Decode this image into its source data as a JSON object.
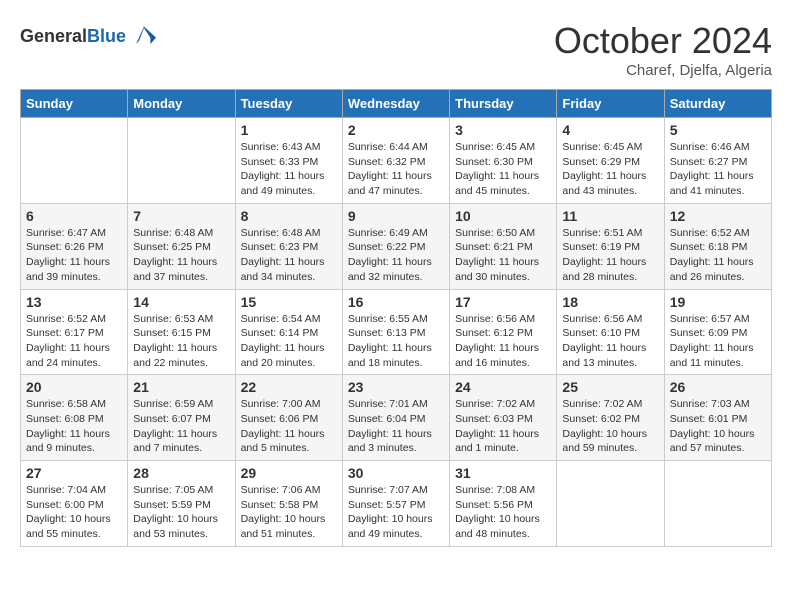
{
  "header": {
    "logo_general": "General",
    "logo_blue": "Blue",
    "month_title": "October 2024",
    "location": "Charef, Djelfa, Algeria"
  },
  "weekdays": [
    "Sunday",
    "Monday",
    "Tuesday",
    "Wednesday",
    "Thursday",
    "Friday",
    "Saturday"
  ],
  "weeks": [
    [
      {
        "day": "",
        "info": ""
      },
      {
        "day": "",
        "info": ""
      },
      {
        "day": "1",
        "info": "Sunrise: 6:43 AM\nSunset: 6:33 PM\nDaylight: 11 hours and 49 minutes."
      },
      {
        "day": "2",
        "info": "Sunrise: 6:44 AM\nSunset: 6:32 PM\nDaylight: 11 hours and 47 minutes."
      },
      {
        "day": "3",
        "info": "Sunrise: 6:45 AM\nSunset: 6:30 PM\nDaylight: 11 hours and 45 minutes."
      },
      {
        "day": "4",
        "info": "Sunrise: 6:45 AM\nSunset: 6:29 PM\nDaylight: 11 hours and 43 minutes."
      },
      {
        "day": "5",
        "info": "Sunrise: 6:46 AM\nSunset: 6:27 PM\nDaylight: 11 hours and 41 minutes."
      }
    ],
    [
      {
        "day": "6",
        "info": "Sunrise: 6:47 AM\nSunset: 6:26 PM\nDaylight: 11 hours and 39 minutes."
      },
      {
        "day": "7",
        "info": "Sunrise: 6:48 AM\nSunset: 6:25 PM\nDaylight: 11 hours and 37 minutes."
      },
      {
        "day": "8",
        "info": "Sunrise: 6:48 AM\nSunset: 6:23 PM\nDaylight: 11 hours and 34 minutes."
      },
      {
        "day": "9",
        "info": "Sunrise: 6:49 AM\nSunset: 6:22 PM\nDaylight: 11 hours and 32 minutes."
      },
      {
        "day": "10",
        "info": "Sunrise: 6:50 AM\nSunset: 6:21 PM\nDaylight: 11 hours and 30 minutes."
      },
      {
        "day": "11",
        "info": "Sunrise: 6:51 AM\nSunset: 6:19 PM\nDaylight: 11 hours and 28 minutes."
      },
      {
        "day": "12",
        "info": "Sunrise: 6:52 AM\nSunset: 6:18 PM\nDaylight: 11 hours and 26 minutes."
      }
    ],
    [
      {
        "day": "13",
        "info": "Sunrise: 6:52 AM\nSunset: 6:17 PM\nDaylight: 11 hours and 24 minutes."
      },
      {
        "day": "14",
        "info": "Sunrise: 6:53 AM\nSunset: 6:15 PM\nDaylight: 11 hours and 22 minutes."
      },
      {
        "day": "15",
        "info": "Sunrise: 6:54 AM\nSunset: 6:14 PM\nDaylight: 11 hours and 20 minutes."
      },
      {
        "day": "16",
        "info": "Sunrise: 6:55 AM\nSunset: 6:13 PM\nDaylight: 11 hours and 18 minutes."
      },
      {
        "day": "17",
        "info": "Sunrise: 6:56 AM\nSunset: 6:12 PM\nDaylight: 11 hours and 16 minutes."
      },
      {
        "day": "18",
        "info": "Sunrise: 6:56 AM\nSunset: 6:10 PM\nDaylight: 11 hours and 13 minutes."
      },
      {
        "day": "19",
        "info": "Sunrise: 6:57 AM\nSunset: 6:09 PM\nDaylight: 11 hours and 11 minutes."
      }
    ],
    [
      {
        "day": "20",
        "info": "Sunrise: 6:58 AM\nSunset: 6:08 PM\nDaylight: 11 hours and 9 minutes."
      },
      {
        "day": "21",
        "info": "Sunrise: 6:59 AM\nSunset: 6:07 PM\nDaylight: 11 hours and 7 minutes."
      },
      {
        "day": "22",
        "info": "Sunrise: 7:00 AM\nSunset: 6:06 PM\nDaylight: 11 hours and 5 minutes."
      },
      {
        "day": "23",
        "info": "Sunrise: 7:01 AM\nSunset: 6:04 PM\nDaylight: 11 hours and 3 minutes."
      },
      {
        "day": "24",
        "info": "Sunrise: 7:02 AM\nSunset: 6:03 PM\nDaylight: 11 hours and 1 minute."
      },
      {
        "day": "25",
        "info": "Sunrise: 7:02 AM\nSunset: 6:02 PM\nDaylight: 10 hours and 59 minutes."
      },
      {
        "day": "26",
        "info": "Sunrise: 7:03 AM\nSunset: 6:01 PM\nDaylight: 10 hours and 57 minutes."
      }
    ],
    [
      {
        "day": "27",
        "info": "Sunrise: 7:04 AM\nSunset: 6:00 PM\nDaylight: 10 hours and 55 minutes."
      },
      {
        "day": "28",
        "info": "Sunrise: 7:05 AM\nSunset: 5:59 PM\nDaylight: 10 hours and 53 minutes."
      },
      {
        "day": "29",
        "info": "Sunrise: 7:06 AM\nSunset: 5:58 PM\nDaylight: 10 hours and 51 minutes."
      },
      {
        "day": "30",
        "info": "Sunrise: 7:07 AM\nSunset: 5:57 PM\nDaylight: 10 hours and 49 minutes."
      },
      {
        "day": "31",
        "info": "Sunrise: 7:08 AM\nSunset: 5:56 PM\nDaylight: 10 hours and 48 minutes."
      },
      {
        "day": "",
        "info": ""
      },
      {
        "day": "",
        "info": ""
      }
    ]
  ]
}
